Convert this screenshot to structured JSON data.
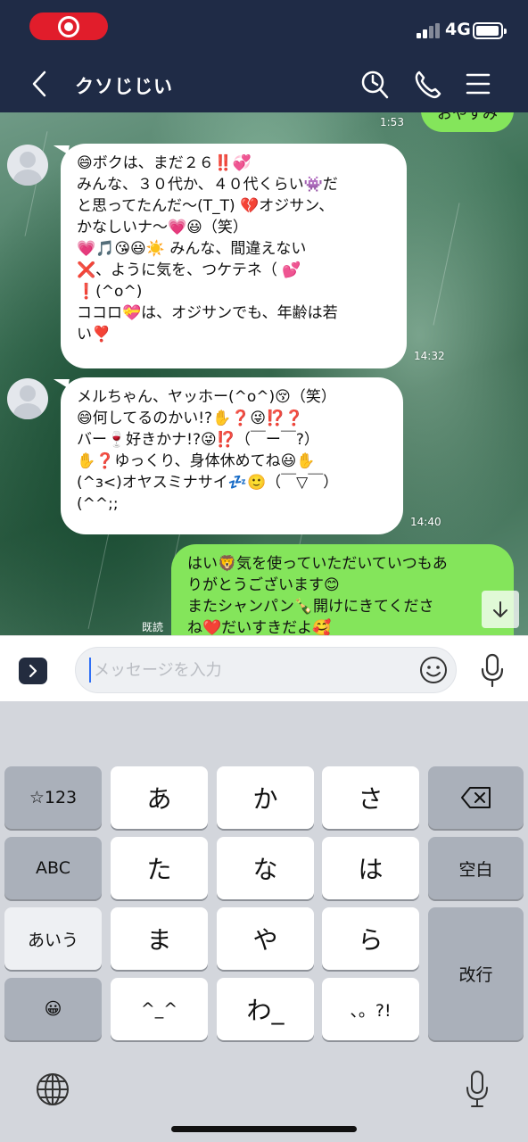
{
  "status_bar": {
    "network": "4G"
  },
  "header": {
    "title": "クソじじい"
  },
  "chat": {
    "top_partial": {
      "text": "おやすみ",
      "time": "1:53"
    },
    "messages": [
      {
        "sender": "other",
        "time": "14:32",
        "lines": [
          "😄ボクは、まだ２６‼️💞",
          "みんな、３０代か、４０代くらい👾だ",
          "と思ってたんだ〜(T_T) 💔オジサン、",
          "かなしいナ〜💗😃（笑）",
          "💗🎵😘😃☀️ みんな、間違えない",
          "❌、ように気を、つケテネ（ 💕",
          "❗️(^o^)",
          "ココロ💝は、オジサンでも、年齢は若",
          "い❣️"
        ]
      },
      {
        "sender": "other",
        "time": "14:40",
        "lines": [
          "メルちゃん、ヤッホー(^o^)😚（笑）",
          "😄何してるのかい!?✋❓😜⁉️❓",
          "バー🍷好きかナ!?😜⁉️（￣ー￣?）",
          "✋❓ゆっくり、身体休めてね😃✋",
          "(^з<)オヤスミナサイ💤🙂（￣▽￣）",
          "(^^;;"
        ]
      },
      {
        "sender": "me",
        "read_label": "既読",
        "lines": [
          "はい🦁気を使っていただいていつもあ",
          "りがとうございます😊",
          "またシャンパン🍾開けにきてくださ",
          "ね❤️だいすきだよ🥰"
        ]
      }
    ]
  },
  "input": {
    "placeholder": "メッセージを入力"
  },
  "keyboard": {
    "rows": [
      [
        "☆123",
        "あ",
        "か",
        "さ",
        "⌫"
      ],
      [
        "ABC",
        "た",
        "な",
        "は",
        "空白"
      ],
      [
        "あいう",
        "ま",
        "や",
        "ら",
        "改行"
      ],
      [
        "😀",
        "^_^",
        "わ_",
        "、。?!"
      ]
    ],
    "keys": {
      "num": "☆123",
      "a": "あ",
      "ka": "か",
      "sa": "さ",
      "abc": "ABC",
      "ta": "た",
      "na": "な",
      "ha": "は",
      "space": "空白",
      "aiu": "あいう",
      "ma": "ま",
      "ya": "や",
      "ra": "ら",
      "enter": "改行",
      "emoji": "😀",
      "kao": "^_^",
      "wa": "わ_",
      "punct": "、。?!"
    }
  }
}
